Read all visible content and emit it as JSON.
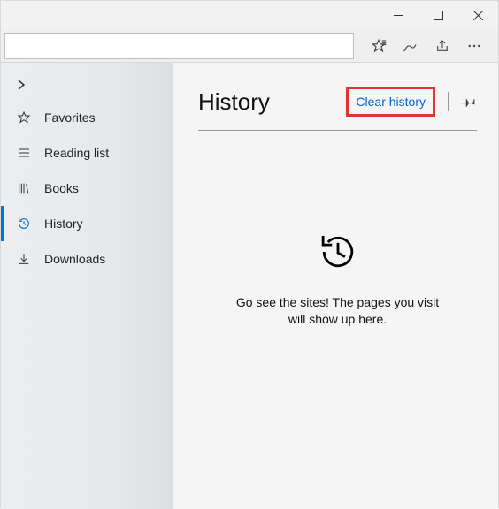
{
  "sidebar": {
    "items": [
      {
        "label": "Favorites"
      },
      {
        "label": "Reading list"
      },
      {
        "label": "Books"
      },
      {
        "label": "History"
      },
      {
        "label": "Downloads"
      }
    ]
  },
  "content": {
    "title": "History",
    "clear_link": "Clear history",
    "empty_line1": "Go see the sites! The pages you visit",
    "empty_line2": "will show up here."
  }
}
